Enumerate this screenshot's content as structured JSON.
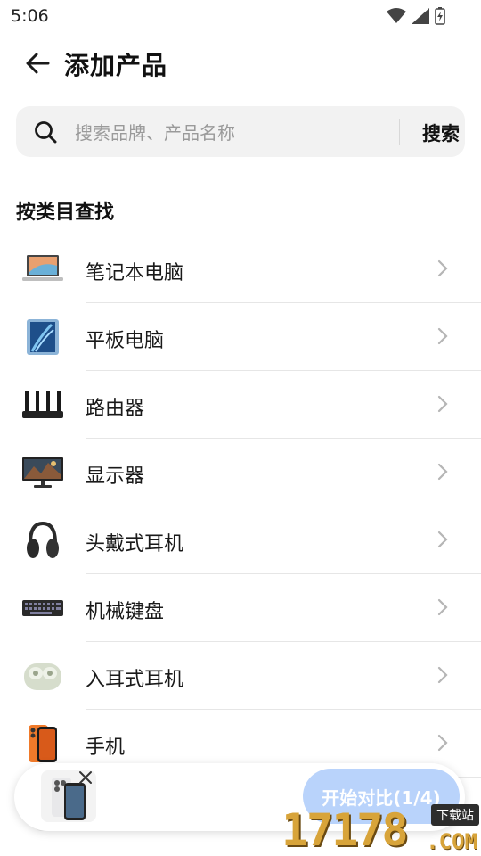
{
  "status_bar": {
    "time": "5:06"
  },
  "header": {
    "title": "添加产品"
  },
  "search": {
    "placeholder": "搜索品牌、产品名称",
    "button_label": "搜索"
  },
  "section": {
    "title": "按类目查找"
  },
  "categories": [
    {
      "label": "笔记本电脑",
      "icon": "laptop-icon"
    },
    {
      "label": "平板电脑",
      "icon": "tablet-icon"
    },
    {
      "label": "路由器",
      "icon": "router-icon"
    },
    {
      "label": "显示器",
      "icon": "monitor-icon"
    },
    {
      "label": "头戴式耳机",
      "icon": "headphones-icon"
    },
    {
      "label": "机械键盘",
      "icon": "keyboard-icon"
    },
    {
      "label": "入耳式耳机",
      "icon": "earbuds-icon"
    },
    {
      "label": "手机",
      "icon": "phone-icon"
    }
  ],
  "compare": {
    "button_label": "开始对比(1/4)",
    "selected_count": 1,
    "max_count": 4
  },
  "watermark": {
    "digits": "17178",
    "tag": "下载站",
    "domain": ".COM"
  },
  "colors": {
    "accent_disabled": "#b9d3fb",
    "search_bg": "#f2f2f2",
    "divider": "#e6e6e6"
  }
}
